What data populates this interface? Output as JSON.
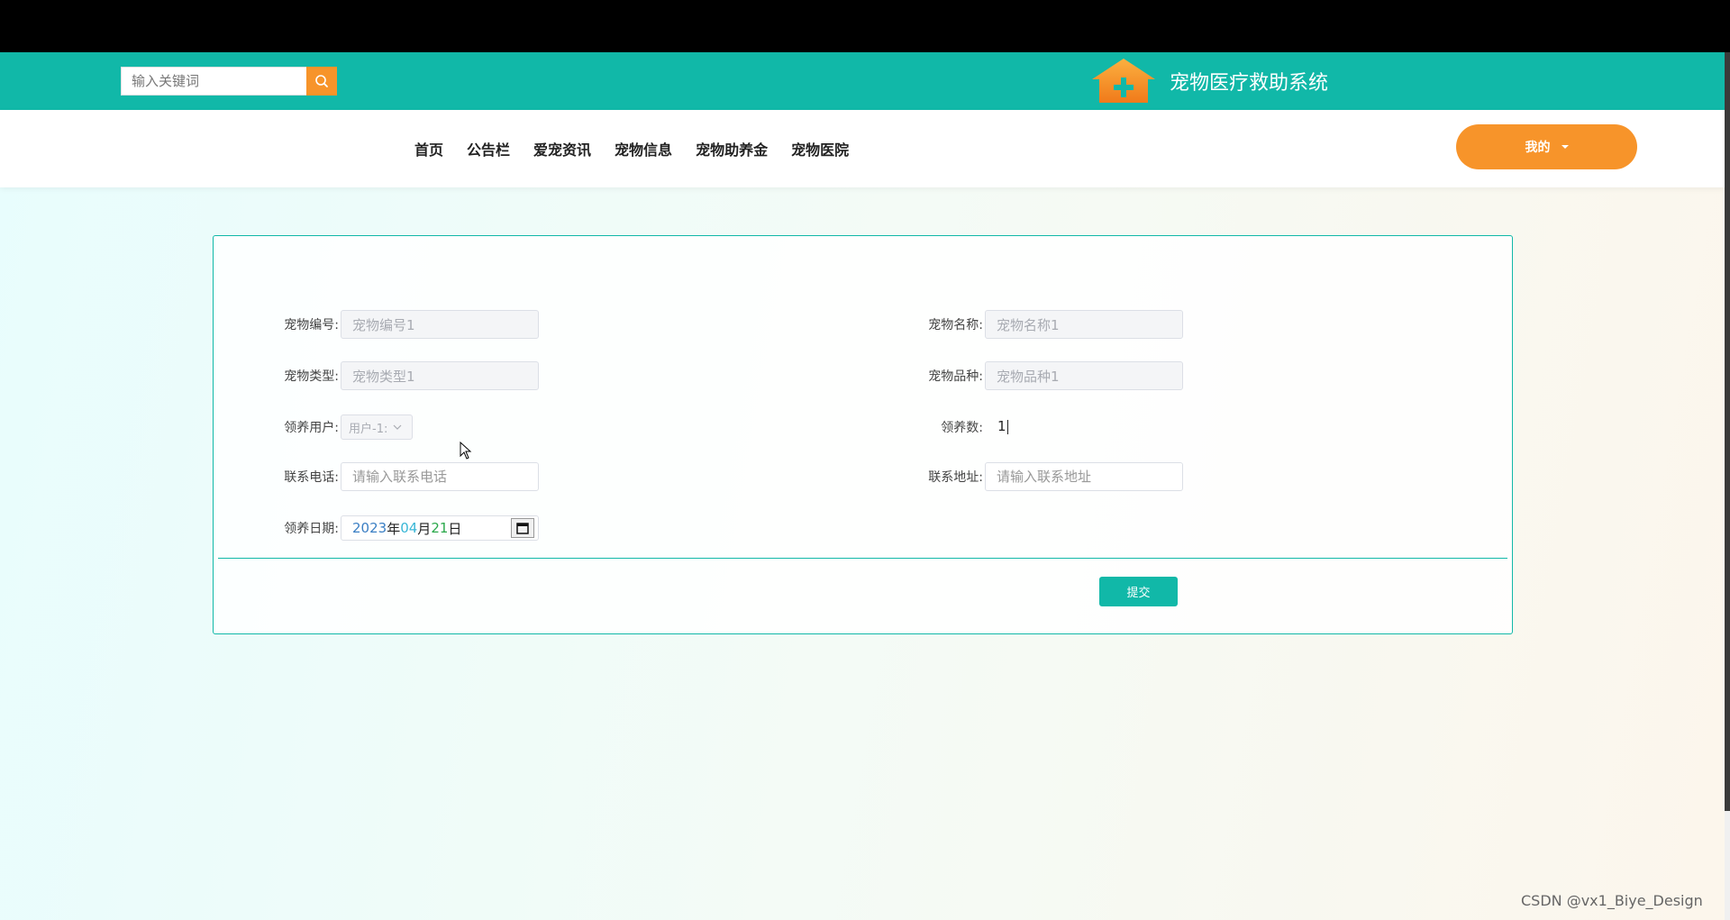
{
  "header": {
    "search_placeholder": "输入关键词",
    "brand_title": "宠物医疗救助系统",
    "accent_color": "#11b8a8",
    "orange_color": "#f7942a"
  },
  "nav": {
    "items": [
      "首页",
      "公告栏",
      "爱宠资讯",
      "宠物信息",
      "宠物助养金",
      "宠物医院"
    ],
    "my_label": "我的"
  },
  "form": {
    "pet_code": {
      "label": "宠物编号:",
      "value": "宠物编号1"
    },
    "pet_name": {
      "label": "宠物名称:",
      "value": "宠物名称1"
    },
    "pet_type": {
      "label": "宠物类型:",
      "value": "宠物类型1"
    },
    "pet_breed": {
      "label": "宠物品种:",
      "value": "宠物品种1"
    },
    "adopt_user": {
      "label": "领养用户:",
      "value": "用户-1:"
    },
    "adopt_count": {
      "label": "领养数:",
      "value": "1"
    },
    "phone": {
      "label": "联系电话:",
      "placeholder": "请输入联系电话"
    },
    "address": {
      "label": "联系地址:",
      "placeholder": "请输入联系地址"
    },
    "adopt_date": {
      "label": "领养日期:",
      "year": "2023",
      "year_unit": "年",
      "month": "04",
      "month_unit": "月",
      "day": "21",
      "day_unit": "日"
    },
    "submit_label": "提交"
  },
  "watermark": "CSDN @vx1_Biye_Design"
}
